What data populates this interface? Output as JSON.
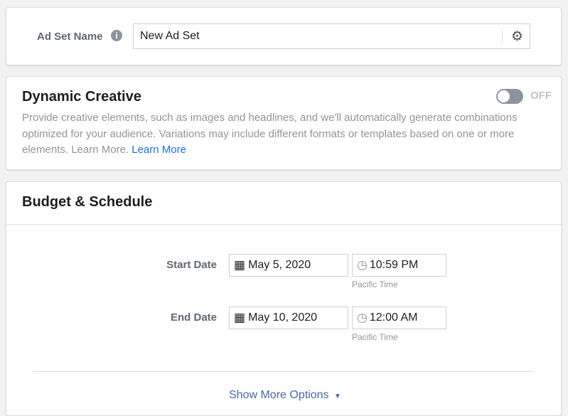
{
  "ad_set_name": {
    "label": "Ad Set Name",
    "value": "New Ad Set"
  },
  "dynamic_creative": {
    "title": "Dynamic Creative",
    "toggle_state": "OFF",
    "description": "Provide creative elements, such as images and headlines, and we'll automatically generate combinations optimized for your audience. Variations may include different formats or templates based on one or more elements. Learn More.",
    "learn_more": "Learn More"
  },
  "budget_schedule": {
    "title": "Budget & Schedule",
    "start": {
      "label": "Start Date",
      "date": "May 5, 2020",
      "time": "10:59 PM",
      "timezone": "Pacific Time"
    },
    "end": {
      "label": "End Date",
      "date": "May 10, 2020",
      "time": "12:00 AM",
      "timezone": "Pacific Time"
    },
    "show_more": "Show More Options"
  },
  "colors": {
    "link": "#1a6ed8",
    "show_more": "#4b67a1"
  }
}
